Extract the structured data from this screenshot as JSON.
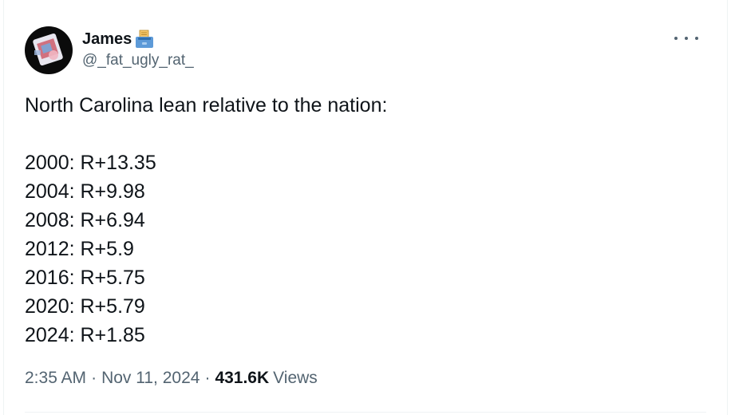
{
  "author": {
    "display_name": "James",
    "name_emoji_icon": "ballot-box-icon",
    "handle": "@_fat_ugly_rat_",
    "avatar_icon": "avatar-image"
  },
  "more_icon": "more-horizontal-icon",
  "tweet": {
    "intro": "North Carolina lean relative to the nation:",
    "lines": [
      "2000: R+13.35",
      "2004: R+9.98",
      "2008: R+6.94",
      "2012: R+5.9",
      "2016: R+5.75",
      "2020: R+5.79",
      "2024: R+1.85"
    ]
  },
  "meta": {
    "time": "2:35 AM",
    "separator": "·",
    "date": "Nov 11, 2024",
    "views_count": "431.6K",
    "views_label": "Views"
  },
  "colors": {
    "text": "#0f1419",
    "secondary": "#536471",
    "divider": "#eff3f4"
  }
}
